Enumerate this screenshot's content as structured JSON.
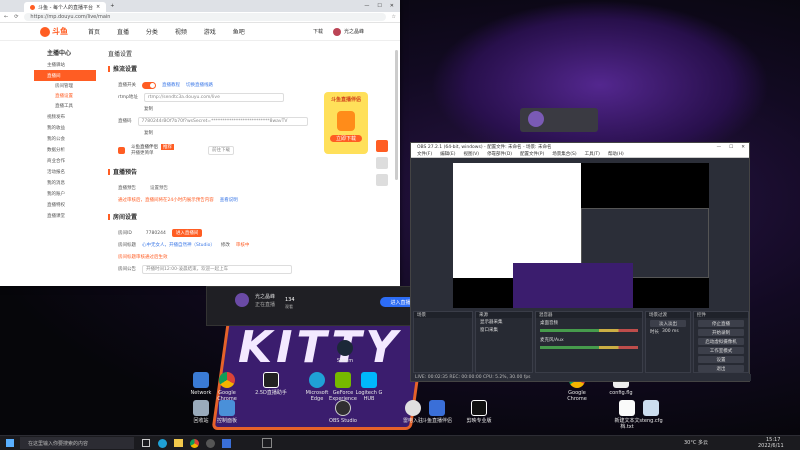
{
  "browser": {
    "tab_title": "斗鱼 - 每个人的直播平台",
    "url": "https://mp.douyu.com/live/main",
    "header_right": "下载",
    "user_name": "光之晶峰"
  },
  "site": {
    "logo_text": "斗鱼",
    "nav": [
      "首页",
      "直播",
      "分类",
      "视频",
      "游戏",
      "鱼吧"
    ]
  },
  "sidebar": {
    "title": "主播中心",
    "items": [
      {
        "label": "主播驿站"
      },
      {
        "label": "直播间"
      },
      {
        "label": "房间管理"
      },
      {
        "label": "直播设置"
      },
      {
        "label": "直播工具"
      },
      {
        "label": "视频发布"
      },
      {
        "label": "我的收益"
      },
      {
        "label": "我的公会"
      },
      {
        "label": "数据分析"
      },
      {
        "label": "商业合作"
      },
      {
        "label": "活动报名"
      },
      {
        "label": "我的消息"
      },
      {
        "label": "我的账户"
      },
      {
        "label": "直播特权"
      },
      {
        "label": "直播课堂"
      }
    ]
  },
  "content": {
    "page_title": "直播设置",
    "s1_title": "推流设置",
    "s1_row1_label": "直播开关",
    "s1_row1_link1": "直播教程",
    "s1_row1_link2": "切换直播线路",
    "rtmp_label": "rtmp地址",
    "rtmp_value": "rtmp://sendtc3a.douyu.com/live",
    "copy": "复制",
    "key_label": "直播码",
    "key_value": "7780244rBOf7b70f?wsSecret=**************************8wavTV",
    "assistant_name": "斗鱼直播伴侣",
    "assistant_desc": "开播更简单",
    "assistant_download": "前往下载",
    "assistant_badge": "推荐",
    "s2_title": "直播预告",
    "s2_label": "直播预告",
    "s2_value": "设置预告",
    "s2_tip": "通过审核后，直播间将在24小时内展示预告内容",
    "s2_link": "查看说明",
    "s3_title": "房间设置",
    "room_id_label": "房间ID",
    "room_id_value": "7780244",
    "room_id_button": "进入直播间",
    "room_name_label": "房间标题",
    "room_name_value": "心中无女人，开播自然神（Studio）",
    "room_name_edit": "修改",
    "room_name_note": "审核中",
    "room_name_tip": "房间标题审核通过后生效",
    "room_notice_label": "房间公告",
    "room_notice_value": "开播时间12:00-凌晨结束，欢迎一起上车"
  },
  "promo": {
    "title": "斗鱼直播伴侣",
    "button": "立即下载"
  },
  "live_popup": {
    "name": "光之晶峰",
    "status": "正在直播",
    "count": "134",
    "count_label": "观看",
    "enter_button": "进入直播间"
  },
  "obs": {
    "title": "OBS 27.2.1 (64-bit, windows) - 配置文件: 未命名 - 场景: 未命名",
    "menu": [
      "文件(F)",
      "编辑(E)",
      "视图(V)",
      "停靠部件(D)",
      "配置文件(P)",
      "场景集合(S)",
      "工具(T)",
      "帮助(H)"
    ],
    "scenes_header": "场景",
    "sources_header": "来源",
    "sources": [
      "显示器采集",
      "窗口采集"
    ],
    "mixer_header": "混音器",
    "mixer_tracks": [
      "桌面音频",
      "麦克风/Aux"
    ],
    "transitions_header": "场景过渡",
    "transition_value": "淡入淡出",
    "duration_label": "时长",
    "duration_value": "300 ms",
    "controls_header": "控件",
    "controls": [
      "停止直播",
      "开始录制",
      "启动虚拟摄像机",
      "工作室模式",
      "设置",
      "退出"
    ],
    "status": "LIVE: 00:02:35   REC: 00:00:00   CPU: 5.2%, 30.00 fps"
  },
  "desktop_icons": [
    {
      "label": "Network"
    },
    {
      "label": "Google Chrome"
    },
    {
      "label": "2.5D直播助手"
    },
    {
      "label": "Microsoft Edge"
    },
    {
      "label": "GeForce Experience"
    },
    {
      "label": "Logitech G HUB"
    },
    {
      "label": "Steam"
    },
    {
      "label": "Google Chrome"
    },
    {
      "label": "config.flg"
    },
    {
      "label": "回收站"
    },
    {
      "label": "控制面板"
    },
    {
      "label": "OBS Studio"
    },
    {
      "label": "雷电入驻"
    },
    {
      "label": "斗鱼直播伴侣"
    },
    {
      "label": "剪映专业版"
    },
    {
      "label": "新建文本文档.txt"
    },
    {
      "label": "steng.cfg"
    }
  ],
  "wallpaper": {
    "text": "KITTY"
  },
  "taskbar": {
    "search_placeholder": "在这里输入你要搜索的内容",
    "weather": "30°C 多云",
    "time": "15:17",
    "date": "2022/6/11"
  },
  "colors": {
    "accent": "#ff5d23",
    "obs_bg": "#2b2e38",
    "purple": "#4b2580"
  }
}
